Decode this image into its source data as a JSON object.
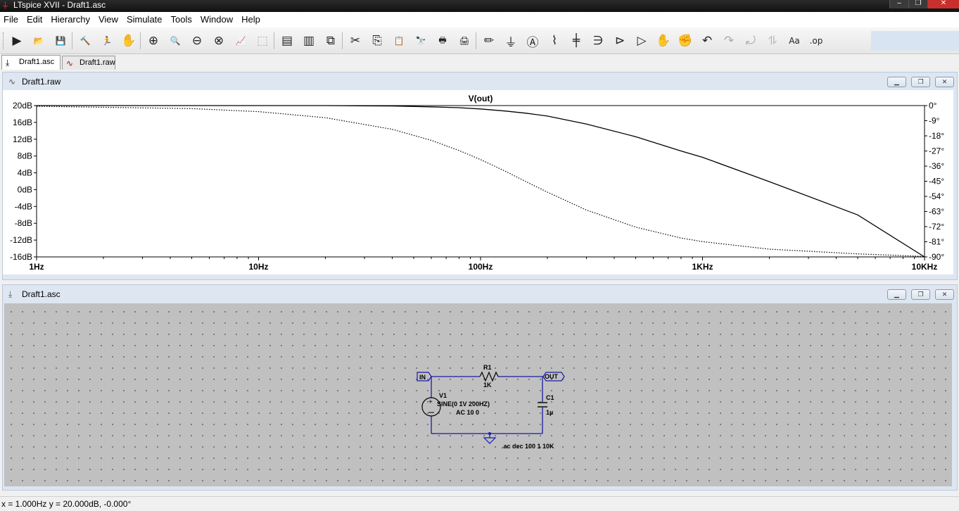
{
  "window": {
    "title": "LTspice XVII - Draft1.asc",
    "minimize": "–",
    "restore": "❐",
    "close": "✕"
  },
  "menu": [
    "File",
    "Edit",
    "Hierarchy",
    "View",
    "Simulate",
    "Tools",
    "Window",
    "Help"
  ],
  "toolbar": {
    "icons": [
      "run-icon",
      "open-icon",
      "save-icon",
      "control-panel-icon",
      "halt-icon",
      "pan-hand-icon",
      "zoom-in-icon",
      "zoom-area-icon",
      "zoom-out-icon",
      "zoom-cancel-icon",
      "autorange-icon",
      "mark-unused-icon",
      "tile-vertical-icon",
      "tile-horizontal-icon",
      "cascade-icon",
      "cut-icon",
      "copy-icon",
      "paste-icon",
      "find-icon",
      "print-icon",
      "print-setup-icon",
      "wire-icon",
      "ground-icon",
      "label-net-icon",
      "resistor-icon",
      "capacitor-icon",
      "inductor-icon",
      "diode-icon",
      "component-icon",
      "move-icon",
      "drag-icon",
      "undo-icon",
      "redo-icon",
      "rotate-icon",
      "mirror-icon",
      "text-icon",
      "spice-directive-icon"
    ],
    "glyphs": [
      "▶",
      "📂",
      "💾",
      "🔨",
      "🏃",
      "✋",
      "⊕",
      "🔍",
      "⊖",
      "⊗",
      "📈",
      "⬚",
      "▤",
      "▥",
      "⧉",
      "✂",
      "⎘",
      "📋",
      "🔭",
      "🖶",
      "🖨",
      "✏",
      "⏚",
      "Ⓐ",
      "⌇",
      "╪",
      "∋",
      "⊳",
      "▷",
      "✋",
      "✊",
      "↶",
      "↷",
      "⤾",
      "⥮",
      "Aa",
      ".op"
    ],
    "disabled": [
      7,
      11,
      32,
      33,
      34
    ]
  },
  "tabs": [
    {
      "label": "Draft1.asc",
      "active": true,
      "icon": "schematic-icon"
    },
    {
      "label": "Draft1.raw",
      "active": false,
      "icon": "waveform-icon"
    }
  ],
  "plot_window": {
    "title": "Draft1.raw"
  },
  "schematic_window": {
    "title": "Draft1.asc"
  },
  "chart_data": {
    "type": "line",
    "title": "V(out)",
    "x_scale": "log",
    "xlim": [
      1,
      10000
    ],
    "x_ticks": [
      {
        "v": 1,
        "label": "1Hz"
      },
      {
        "v": 10,
        "label": "10Hz"
      },
      {
        "v": 100,
        "label": "100Hz"
      },
      {
        "v": 1000,
        "label": "1KHz"
      },
      {
        "v": 10000,
        "label": "10KHz"
      }
    ],
    "ylim_left": [
      -16,
      20
    ],
    "y_left_ticks": [
      "20dB",
      "16dB",
      "12dB",
      "8dB",
      "4dB",
      "0dB",
      "-4dB",
      "-8dB",
      "-12dB",
      "-16dB"
    ],
    "y_left_values": [
      20,
      16,
      12,
      8,
      4,
      0,
      -4,
      -8,
      -12,
      -16
    ],
    "ylim_right": [
      -90,
      0
    ],
    "y_right_ticks": [
      "0°",
      "-9°",
      "-18°",
      "-27°",
      "-36°",
      "-45°",
      "-54°",
      "-63°",
      "-72°",
      "-81°",
      "-90°"
    ],
    "y_right_values": [
      0,
      -9,
      -18,
      -27,
      -36,
      -45,
      -54,
      -63,
      -72,
      -81,
      -90
    ],
    "series": [
      {
        "name": "magnitude",
        "style": "solid",
        "axis": "left",
        "x": [
          1,
          5,
          10,
          20,
          40,
          60,
          80,
          100,
          130,
          160,
          200,
          300,
          500,
          800,
          1000,
          2000,
          5000,
          10000
        ],
        "y": [
          20,
          20,
          20,
          20,
          19.9,
          19.7,
          19.5,
          19.2,
          18.7,
          18.2,
          17.5,
          15.6,
          12.6,
          9.2,
          7.7,
          1.9,
          -6.0,
          -16
        ]
      },
      {
        "name": "phase",
        "style": "dotted",
        "axis": "right",
        "x": [
          1,
          5,
          10,
          20,
          40,
          60,
          80,
          100,
          130,
          160,
          200,
          300,
          500,
          800,
          1000,
          2000,
          5000,
          10000
        ],
        "y": [
          -0.4,
          -1.8,
          -3.6,
          -7.2,
          -14.1,
          -20.7,
          -26.7,
          -32.1,
          -39.2,
          -45.2,
          -51.5,
          -62.1,
          -72.3,
          -78.8,
          -80.9,
          -85.4,
          -88.2,
          -89.7
        ]
      }
    ]
  },
  "schematic": {
    "flag_in": "IN",
    "flag_out": "OUT",
    "r_name": "R1",
    "r_value": "1K",
    "v_name": "V1",
    "v_value": "SINE(0 1V 200HZ)",
    "v_ac": "AC 10 0",
    "c_name": "C1",
    "c_value": "1µ",
    "directive": ".ac dec 100 1 10K"
  },
  "status": {
    "text": "x = 1.000Hz   y = 20.000dB, -0.000°"
  }
}
